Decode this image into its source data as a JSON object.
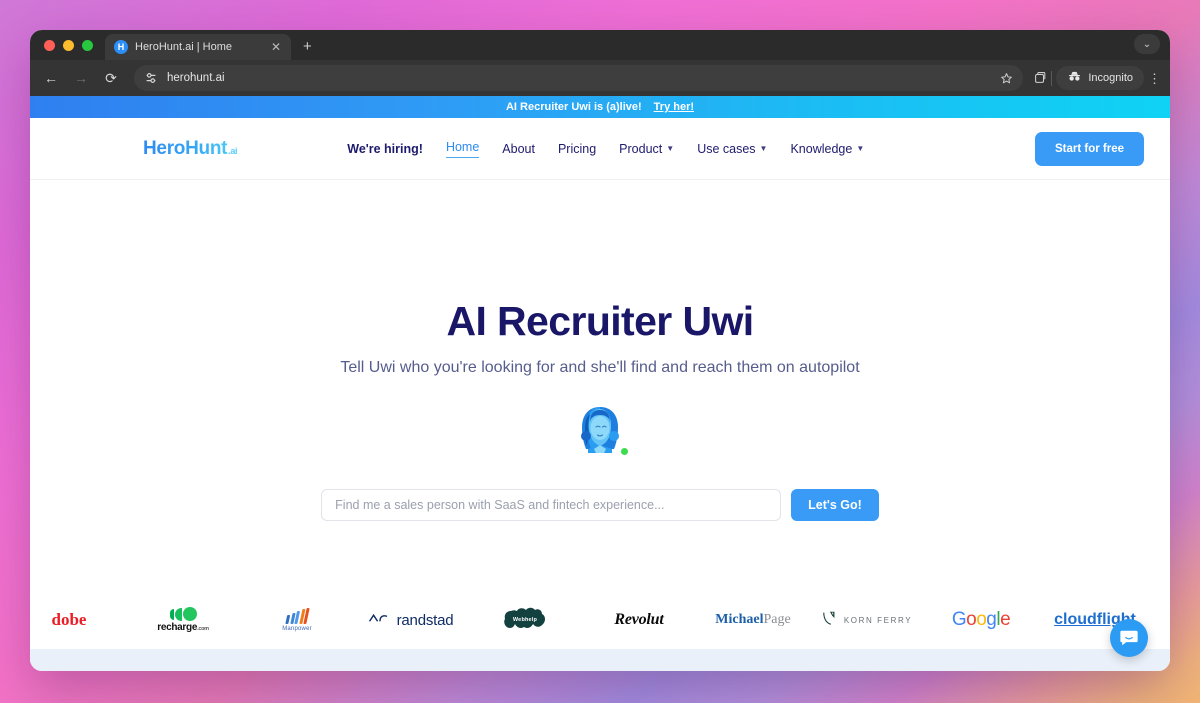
{
  "browser": {
    "tab": {
      "title": "HeroHunt.ai | Home",
      "favicon_letter": "H",
      "close_icon": "close-icon"
    },
    "new_tab_label": "+",
    "window_chevron": "⌄",
    "nav": {
      "back": "←",
      "forward": "→",
      "reload": "⟳"
    },
    "omnibox": {
      "url": "herohunt.ai",
      "site_settings_icon": "tune-icon"
    },
    "actions": {
      "bookmark_icon": "star-icon",
      "tab_groups_icon": "tab-groups-icon",
      "incognito_label": "Incognito",
      "menu_icon": "kebab-menu-icon"
    }
  },
  "promo": {
    "text": "AI Recruiter Uwi is (a)live!",
    "link": "Try her!"
  },
  "site_header": {
    "logo": {
      "name": "HeroHunt",
      "suffix": ".ai"
    },
    "nav_items": [
      {
        "label": "We're hiring!",
        "bold": true,
        "caret": false,
        "active": false
      },
      {
        "label": "Home",
        "bold": false,
        "caret": false,
        "active": true
      },
      {
        "label": "About",
        "bold": false,
        "caret": false,
        "active": false
      },
      {
        "label": "Pricing",
        "bold": false,
        "caret": false,
        "active": false
      },
      {
        "label": "Product",
        "bold": false,
        "caret": true,
        "active": false
      },
      {
        "label": "Use cases",
        "bold": false,
        "caret": true,
        "active": false
      },
      {
        "label": "Knowledge",
        "bold": false,
        "caret": true,
        "active": false
      }
    ],
    "cta_label": "Start for free"
  },
  "hero": {
    "title": "AI Recruiter Uwi",
    "subtitle": "Tell Uwi who you're looking for and she'll find and reach them on autopilot",
    "avatar_name": "uwi-avatar",
    "status": "online",
    "search_placeholder": "Find me a sales person with SaaS and fintech experience...",
    "search_value": "",
    "go_label": "Let's Go!"
  },
  "logo_strip": {
    "brands": [
      {
        "name": "Adobe",
        "display": "dobe",
        "clipped": true
      },
      {
        "name": "recharge.com",
        "display": "recharge",
        "suffix": ".com"
      },
      {
        "name": "Manpower",
        "display": "Manpower"
      },
      {
        "name": "randstad",
        "display": "randstad"
      },
      {
        "name": "Webhelp",
        "display": "Webhelp"
      },
      {
        "name": "Revolut",
        "display": "Revolut"
      },
      {
        "name": "Michael Page",
        "display_bold": "Michael",
        "display_light": "Page"
      },
      {
        "name": "Korn Ferry",
        "display": "KORN FERRY"
      },
      {
        "name": "Google",
        "letters": [
          "G",
          "o",
          "o",
          "g",
          "l",
          "e"
        ]
      },
      {
        "name": "cloudflight",
        "display": "cloudflight"
      }
    ]
  },
  "chat_widget": {
    "icon": "chat-bubble-icon"
  },
  "colors": {
    "accent_blue": "#3a9bf7",
    "headline_navy": "#1a1768",
    "banner_gradient_start": "#2f7ff0",
    "banner_gradient_end": "#0fd3f4",
    "status_green": "#3ddc4e"
  }
}
